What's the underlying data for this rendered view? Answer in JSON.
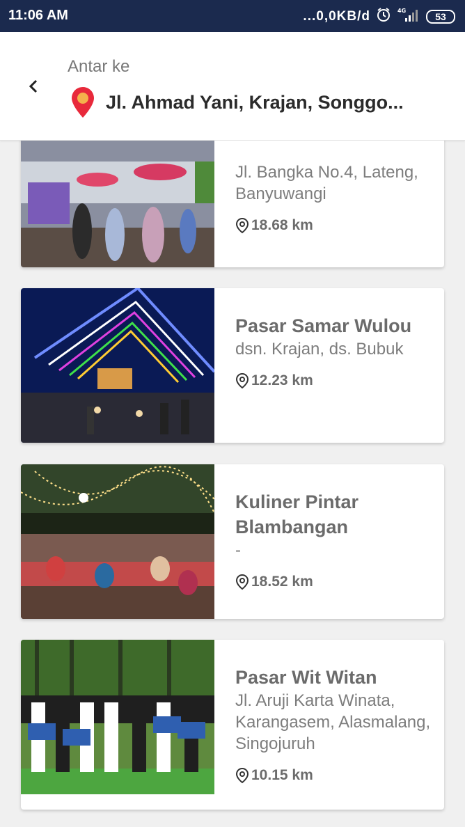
{
  "status_bar": {
    "time": "11:06 AM",
    "network": "...0,0KB/d",
    "signal_label": "4G",
    "battery": "53"
  },
  "header": {
    "label": "Antar ke",
    "address": "Jl. Ahmad Yani, Krajan, Songgo..."
  },
  "markets": [
    {
      "name": "",
      "address": "Jl. Bangka No.4, Lateng, Banyuwangi",
      "distance": "18.68 km"
    },
    {
      "name": "Pasar Samar Wulou",
      "address": "dsn. Krajan, ds. Bubuk",
      "distance": "12.23 km"
    },
    {
      "name": "Kuliner Pintar Blambangan",
      "address": "-",
      "distance": "18.52 km"
    },
    {
      "name": "Pasar Wit Witan",
      "address": "Jl. Aruji Karta Winata, Karangasem, Alasmalang, Singojuruh",
      "distance": "10.15 km"
    }
  ],
  "colors": {
    "status_bar": "#1b2a4e",
    "pin": "#e8293b",
    "pin_center": "#f4b24c",
    "card_text": "#6b6b6b",
    "background": "#f0f0f0"
  }
}
